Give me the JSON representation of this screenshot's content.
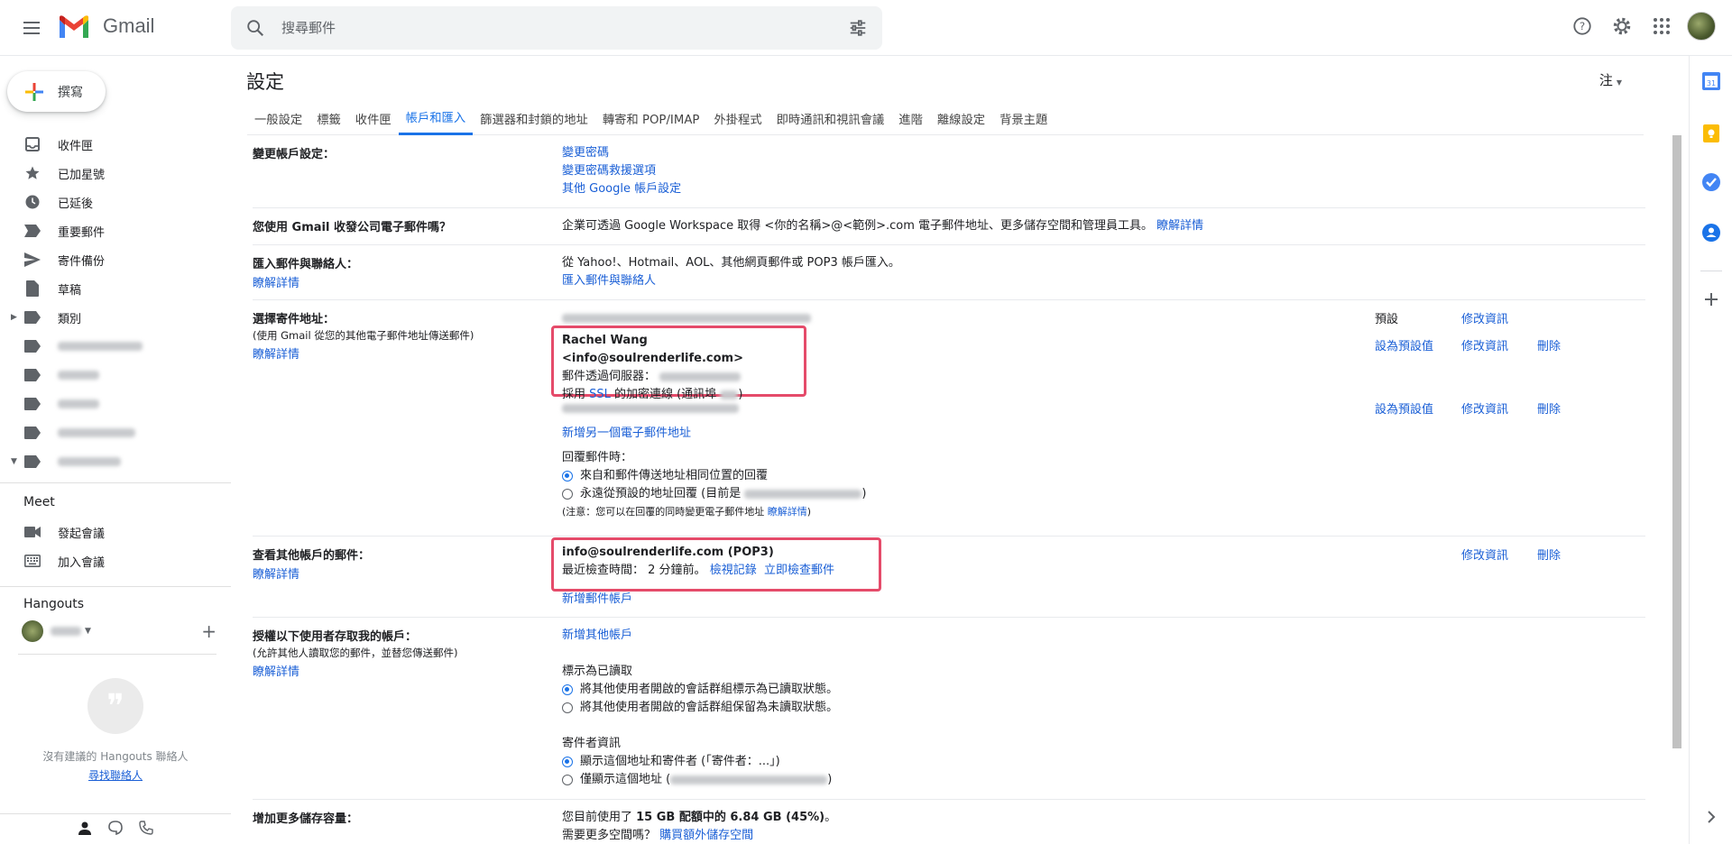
{
  "app": {
    "name": "Gmail"
  },
  "search": {
    "placeholder": "搜尋郵件"
  },
  "compose": {
    "label": "撰寫"
  },
  "sidebar": {
    "items": [
      {
        "label": "收件匣",
        "icon": "inbox-icon"
      },
      {
        "label": "已加星號",
        "icon": "star-icon"
      },
      {
        "label": "已延後",
        "icon": "clock-icon"
      },
      {
        "label": "重要郵件",
        "icon": "important-icon"
      },
      {
        "label": "寄件備份",
        "icon": "send-icon"
      },
      {
        "label": "草稿",
        "icon": "draft-icon"
      },
      {
        "label": "類別",
        "icon": "label-icon"
      }
    ],
    "meet": {
      "title": "Meet",
      "new_meeting": "發起會議",
      "join_meeting": "加入會議"
    },
    "hangouts": {
      "title": "Hangouts",
      "empty_text": "沒有建議的 Hangouts 聯絡人",
      "find_link": "尋找聯絡人"
    }
  },
  "settings": {
    "title": "設定",
    "lang_toggle": "注",
    "tabs": [
      "一般設定",
      "標籤",
      "收件匣",
      "帳戶和匯入",
      "篩選器和封鎖的地址",
      "轉寄和 POP/IMAP",
      "外掛程式",
      "即時通訊和視訊會議",
      "進階",
      "離線設定",
      "背景主題"
    ],
    "active_tab": "帳戶和匯入",
    "rows": {
      "change_account": {
        "label": "變更帳戶設定：",
        "links": [
          "變更密碼",
          "變更密碼救援選項",
          "其他 Google 帳戶設定"
        ]
      },
      "workspace": {
        "label": "您使用 Gmail 收發公司電子郵件嗎？",
        "text": "企業可透過 Google Workspace 取得 <你的名稱>@<範例>.com 電子郵件地址、更多儲存空間和管理員工具。",
        "link": "瞭解詳情"
      },
      "import": {
        "label": "匯入郵件與聯絡人：",
        "learn": "瞭解詳情",
        "text": "從 Yahoo!、Hotmail、AOL、其他網頁郵件或 POP3 帳戶匯入。",
        "link": "匯入郵件與聯絡人"
      },
      "send_as": {
        "label": "選擇寄件地址：",
        "sub": "(使用 Gmail 從您的其他電子郵件地址傳送郵件)",
        "learn": "瞭解詳情",
        "default_tag": "預設",
        "edit": "修改資訊",
        "set_default": "設為預設值",
        "delete": "刪除",
        "account_name": "Rachel Wang <info@soulrenderlife.com>",
        "smtp_label": "郵件透過伺服器：",
        "ssl_prefix": "採用 ",
        "ssl_link": "SSL",
        "ssl_suffix": " 的加密連線 (通訊埠 ",
        "ssl_close": ")",
        "add_address": "新增另一個電子郵件地址",
        "reply_title": "回覆郵件時：",
        "reply_opt1": "來自和郵件傳送地址相同位置的回覆",
        "reply_opt2": "永遠從預設的地址回覆 (目前是",
        "reply_opt2_end": ")",
        "note": "(注意：您可以在回覆的同時變更電子郵件地址",
        "note_link": "瞭解詳情",
        "note_end": ")"
      },
      "check_mail": {
        "label": "查看其他帳戶的郵件：",
        "learn": "瞭解詳情",
        "account": "info@soulrenderlife.com (POP3)",
        "last_check": "最近檢查時間： 2 分鐘前。",
        "history": "檢視記錄",
        "check_now": "立即檢查郵件",
        "add_account": "新增郵件帳戶",
        "edit": "修改資訊",
        "delete": "刪除"
      },
      "grant": {
        "label": "授權以下使用者存取我的帳戶：",
        "sub": "(允許其他人讀取您的郵件，並替您傳送郵件)",
        "learn": "瞭解詳情",
        "add_account": "新增其他帳戶",
        "read_title": "標示為已讀取",
        "read_opt1": "將其他使用者開啟的會話群組標示為已讀取狀態。",
        "read_opt2": "將其他使用者開啟的會話群組保留為未讀取狀態。",
        "sender_title": "寄件者資訊",
        "sender_opt1": "顯示這個地址和寄件者 (「寄件者：...」)",
        "sender_opt2": "僅顯示這個地址 (",
        "sender_opt2_end": ")"
      },
      "storage": {
        "label": "增加更多儲存容量：",
        "text_pre": "您目前使用了 ",
        "text_bold": "15 GB 配額中的 6.84 GB (45%)",
        "text_post": "。",
        "more_q": "需要更多空間嗎？",
        "buy_link": "購買額外儲存空間"
      }
    }
  },
  "colors": {
    "accent": "#1a73e8",
    "highlight_box": "#e54b6a",
    "link": "#1a5fd6"
  }
}
